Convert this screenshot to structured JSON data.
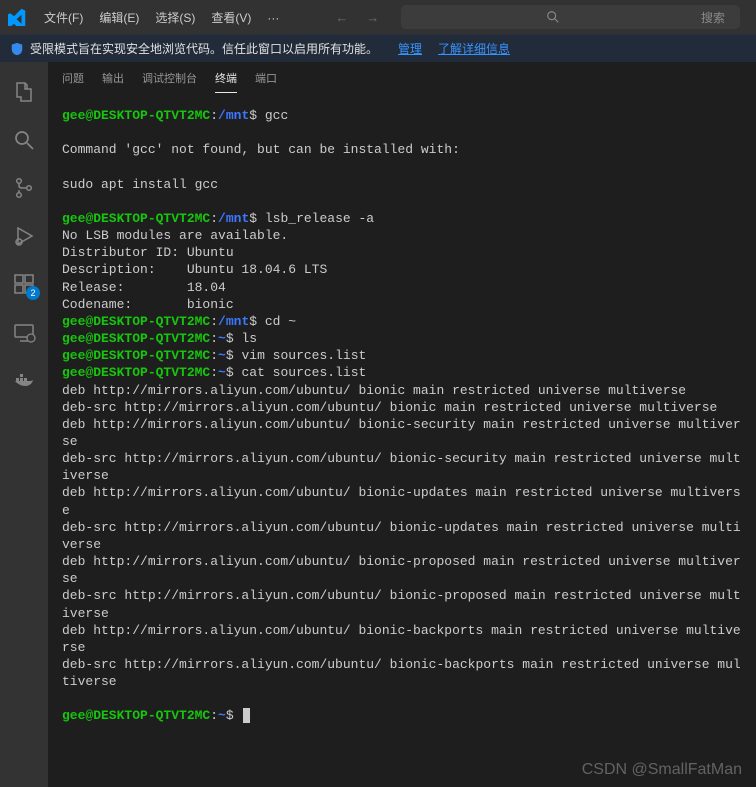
{
  "menubar": {
    "items": [
      "文件(F)",
      "编辑(E)",
      "选择(S)",
      "查看(V)",
      "···"
    ]
  },
  "search": {
    "placeholder": "搜索"
  },
  "restricted": {
    "text": "受限模式旨在实现安全地浏览代码。信任此窗口以启用所有功能。",
    "links": [
      "管理",
      "了解详细信息"
    ]
  },
  "activity": {
    "items": [
      {
        "name": "explorer-icon"
      },
      {
        "name": "search-icon"
      },
      {
        "name": "source-control-icon"
      },
      {
        "name": "run-debug-icon"
      },
      {
        "name": "extensions-icon",
        "badge": "2"
      },
      {
        "name": "remote-explorer-icon"
      },
      {
        "name": "docker-icon"
      }
    ]
  },
  "panel": {
    "tabs": [
      "问题",
      "输出",
      "调试控制台",
      "终端",
      "端口"
    ],
    "active": 3
  },
  "terminal": {
    "lines": [
      {
        "t": "prompt",
        "user": "gee@DESKTOP-QTVT2MC",
        "path": "/mnt",
        "cmd": "gcc"
      },
      {
        "t": "blank"
      },
      {
        "t": "out",
        "text": "Command 'gcc' not found, but can be installed with:"
      },
      {
        "t": "blank"
      },
      {
        "t": "out",
        "text": "sudo apt install gcc"
      },
      {
        "t": "blank"
      },
      {
        "t": "prompt",
        "user": "gee@DESKTOP-QTVT2MC",
        "path": "/mnt",
        "cmd": "lsb_release -a"
      },
      {
        "t": "out",
        "text": "No LSB modules are available."
      },
      {
        "t": "out",
        "text": "Distributor ID: Ubuntu"
      },
      {
        "t": "out",
        "text": "Description:    Ubuntu 18.04.6 LTS"
      },
      {
        "t": "out",
        "text": "Release:        18.04"
      },
      {
        "t": "out",
        "text": "Codename:       bionic"
      },
      {
        "t": "prompt",
        "user": "gee@DESKTOP-QTVT2MC",
        "path": "/mnt",
        "cmd": "cd ~"
      },
      {
        "t": "prompt",
        "user": "gee@DESKTOP-QTVT2MC",
        "path": "~",
        "cmd": "ls"
      },
      {
        "t": "prompt",
        "user": "gee@DESKTOP-QTVT2MC",
        "path": "~",
        "cmd": "vim sources.list"
      },
      {
        "t": "prompt",
        "user": "gee@DESKTOP-QTVT2MC",
        "path": "~",
        "cmd": "cat sources.list"
      },
      {
        "t": "out",
        "text": "deb http://mirrors.aliyun.com/ubuntu/ bionic main restricted universe multiverse"
      },
      {
        "t": "out",
        "text": "deb-src http://mirrors.aliyun.com/ubuntu/ bionic main restricted universe multiverse"
      },
      {
        "t": "out",
        "text": "deb http://mirrors.aliyun.com/ubuntu/ bionic-security main restricted universe multiverse"
      },
      {
        "t": "out",
        "text": "deb-src http://mirrors.aliyun.com/ubuntu/ bionic-security main restricted universe multiverse"
      },
      {
        "t": "out",
        "text": "deb http://mirrors.aliyun.com/ubuntu/ bionic-updates main restricted universe multiverse"
      },
      {
        "t": "out",
        "text": "deb-src http://mirrors.aliyun.com/ubuntu/ bionic-updates main restricted universe multiverse"
      },
      {
        "t": "out",
        "text": "deb http://mirrors.aliyun.com/ubuntu/ bionic-proposed main restricted universe multiverse"
      },
      {
        "t": "out",
        "text": "deb-src http://mirrors.aliyun.com/ubuntu/ bionic-proposed main restricted universe multiverse"
      },
      {
        "t": "out",
        "text": "deb http://mirrors.aliyun.com/ubuntu/ bionic-backports main restricted universe multiverse"
      },
      {
        "t": "out",
        "text": "deb-src http://mirrors.aliyun.com/ubuntu/ bionic-backports main restricted universe multiverse"
      },
      {
        "t": "blank"
      },
      {
        "t": "prompt",
        "user": "gee@DESKTOP-QTVT2MC",
        "path": "~",
        "cmd": "",
        "cursor": true
      }
    ]
  },
  "watermark": "CSDN @SmallFatMan"
}
